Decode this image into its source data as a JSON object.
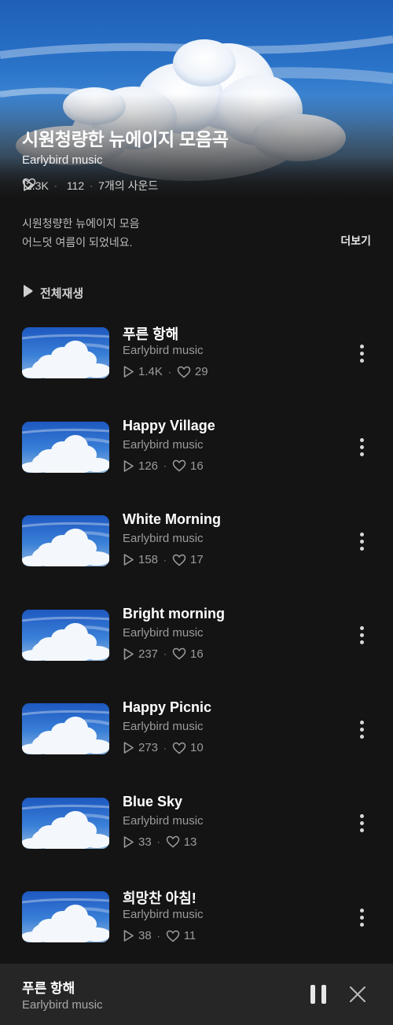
{
  "playlist": {
    "title": "시원청량한 뉴에이지 모음곡",
    "artist": "Earlybird music",
    "plays": "2.3K",
    "likes": "112",
    "sound_count": "7개의 사운드",
    "description_line1": "시원청량한 뉴에이지 모음",
    "description_line2": "어느덧 여름이 되었네요.",
    "more_label": "더보기",
    "play_all_label": "전체재생"
  },
  "tracks": [
    {
      "title": "푸른 항해",
      "artist": "Earlybird music",
      "plays": "1.4K",
      "likes": "29"
    },
    {
      "title": "Happy Village",
      "artist": "Earlybird music",
      "plays": "126",
      "likes": "16"
    },
    {
      "title": "White Morning",
      "artist": "Earlybird music",
      "plays": "158",
      "likes": "17"
    },
    {
      "title": "Bright morning",
      "artist": "Earlybird music",
      "plays": "237",
      "likes": "16"
    },
    {
      "title": "Happy Picnic",
      "artist": "Earlybird music",
      "plays": "273",
      "likes": "10"
    },
    {
      "title": "Blue Sky",
      "artist": "Earlybird music",
      "plays": "33",
      "likes": "13"
    },
    {
      "title": "희망찬 아침!",
      "artist": "Earlybird music",
      "plays": "38",
      "likes": "11"
    }
  ],
  "player": {
    "title": "푸른 항해",
    "artist": "Earlybird music"
  },
  "separator": "·",
  "icons": {
    "play": "play-outline-icon",
    "heart": "heart-outline-icon",
    "more": "more-vertical-icon",
    "pause": "pause-icon",
    "close": "close-icon"
  },
  "colors": {
    "background": "#141414",
    "mini_player": "#262626",
    "primary_text": "#ffffff",
    "secondary_text": "#9b9b9b"
  }
}
